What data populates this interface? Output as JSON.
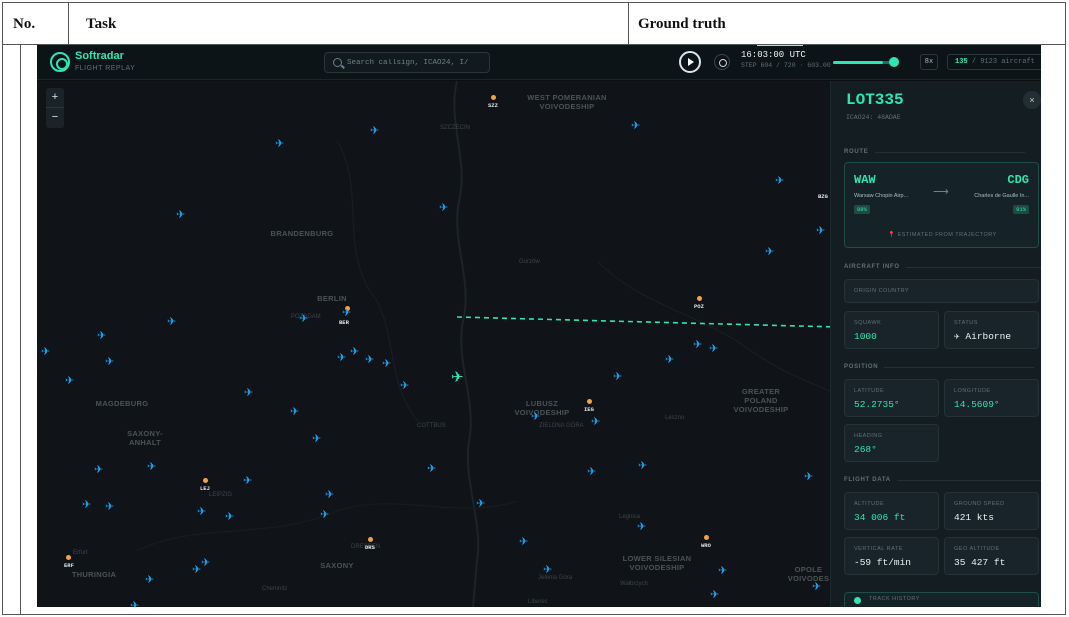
{
  "table": {
    "col_no": "No.",
    "col_task": "Task",
    "col_truth": "Ground truth"
  },
  "app": {
    "brand": "Softradar",
    "brand_sub": "FLIGHT REPLAY",
    "search_placeholder": "Search callsign, ICAO24, I/",
    "time": "16:03:00 UTC",
    "step": "STEP 604 / 720 · 603.00",
    "speed": "8x",
    "aircraft_count": "135",
    "aircraft_total": " / 9123 aircraft",
    "progress": 0.84,
    "accent": "#2ee6b0"
  },
  "map": {
    "zoom_in": "+",
    "zoom_out": "−",
    "regions": [
      "WEST POMERANIAN VOIVODESHIP",
      "BRANDENBURG",
      "BERLIN",
      "MAGDEBURG",
      "SAXONY-ANHALT",
      "LUBUSZ VOIVODESHIP",
      "GREATER POLAND VOIVODESHIP",
      "SAXONY",
      "THURINGIA",
      "LOWER SILESIAN VOIVODESHIP",
      "OPOLE VOIVODES"
    ],
    "cities": [
      "SZCZECIN",
      "POTSDAM",
      "COTTBUS",
      "ZIELONA GÓRA",
      "LEIPZIG",
      "DRESDEN",
      "Chemnitz",
      "Gorzów",
      "Leszno",
      "Legnica",
      "Jelenia Góra",
      "Wałbrzych",
      "Liberec",
      "Erfurt"
    ],
    "airports": [
      "SZZ",
      "BER",
      "IEG",
      "POZ",
      "DRS",
      "LEJ",
      "ERF",
      "WRO",
      "BZG"
    ]
  },
  "panel": {
    "callsign": "LOT335",
    "icao": "ICAO24: 48ADAE",
    "close": "×",
    "route_label": "ROUTE",
    "from_code": "WAW",
    "from_name": "Warsaw Chopin Airp...",
    "from_pct": "88%",
    "to_code": "CDG",
    "to_name": "Charles de Gaulle In...",
    "to_pct": "91%",
    "estimated": "ESTIMATED FROM TRAJECTORY",
    "aircraft_info_label": "AIRCRAFT INFO",
    "origin_country_label": "ORIGIN COUNTRY",
    "squawk_label": "SQUAWK",
    "squawk": "1000",
    "status_label": "STATUS",
    "status": "✈ Airborne",
    "position_label": "POSITION",
    "latitude_label": "LATITUDE",
    "latitude": "52.2735°",
    "longitude_label": "LONGITUDE",
    "longitude": "14.5609°",
    "heading_label": "HEADING",
    "heading": "268°",
    "flight_data_label": "FLIGHT DATA",
    "altitude_label": "ALTITUDE",
    "altitude": "34 006 ft",
    "ground_speed_label": "GROUND SPEED",
    "ground_speed": "421 kts",
    "vertical_rate_label": "VERTICAL RATE",
    "vertical_rate": "-59 ft/min",
    "geo_altitude_label": "GEO ALTITUDE",
    "geo_altitude": "35 427 ft",
    "track_history_label": "TRACK HISTORY"
  }
}
